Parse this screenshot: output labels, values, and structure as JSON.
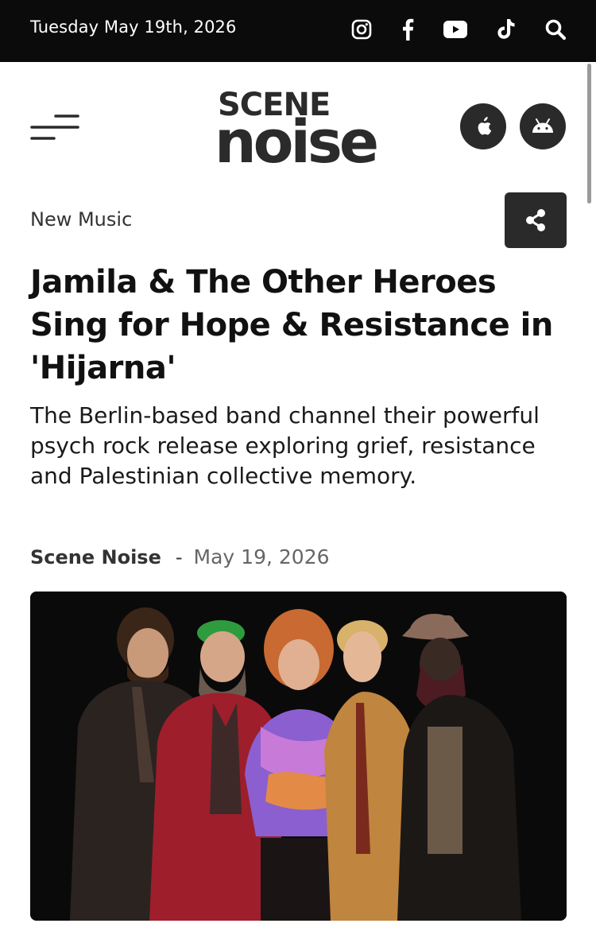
{
  "topbar": {
    "date": "Tuesday May 19th, 2026",
    "social": [
      "instagram-icon",
      "facebook-icon",
      "youtube-icon",
      "tiktok-icon",
      "search-icon"
    ]
  },
  "logo": {
    "line1": "SCENE",
    "line2": "noise"
  },
  "app_buttons": [
    "apple-icon",
    "android-icon"
  ],
  "article": {
    "category": "New Music",
    "title": "Jamila & The Other Heroes Sing for Hope & Resistance in 'Hijarna'",
    "dek": "The Berlin-based band channel their powerful psych rock release exploring grief, resistance and Palestinian collective memory.",
    "author": "Scene Noise",
    "separator": "-",
    "date": "May 19, 2026"
  },
  "colors": {
    "topbar": "#0b0b0b",
    "button_dark": "#2a2a2a"
  }
}
